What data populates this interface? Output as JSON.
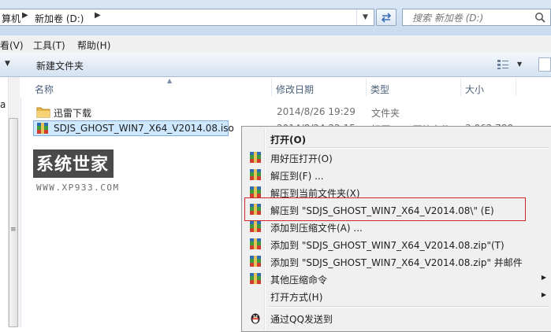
{
  "address": {
    "crumbs": [
      "算机",
      "新加卷 (D:)"
    ],
    "search_placeholder": "搜索 新加卷 (D:)"
  },
  "menubar": {
    "items": [
      "看(V)",
      "工具(T)",
      "帮助(H)"
    ]
  },
  "toolbar": {
    "new_folder": "新建文件夹"
  },
  "nav": {
    "partial_text": "a"
  },
  "columns": {
    "name": "名称",
    "date": "修改日期",
    "type": "类型",
    "size": "大小"
  },
  "files": [
    {
      "name": "迅雷下载",
      "date": "2014/8/26 19:29",
      "type": "文件夹",
      "size": "",
      "icon": "folder-icon"
    },
    {
      "name": "SDJS_GHOST_WIN7_X64_V2014.08.iso",
      "date": "2014/8/24 22:15",
      "type": "好压 ISO 压缩文件",
      "size": "3,062,788",
      "icon": "archive-icon"
    }
  ],
  "watermark": {
    "logo": "系统世家",
    "url": "WWW.XP933.COM"
  },
  "context_menu": {
    "items": [
      {
        "label": "打开(O)",
        "bold": true,
        "icon": "",
        "submenu": false
      },
      {
        "label": "用好压打开(O)",
        "icon": "archive-icon",
        "submenu": false
      },
      {
        "label": "解压到(F) ...",
        "icon": "archive-icon",
        "submenu": false
      },
      {
        "label": "解压到当前文件夹(X)",
        "icon": "archive-icon",
        "submenu": false
      },
      {
        "label": "解压到 \"SDJS_GHOST_WIN7_X64_V2014.08\\\" (E)",
        "icon": "archive-icon",
        "submenu": false,
        "highlighted": true
      },
      {
        "label": "添加到压缩文件(A) ...",
        "icon": "archive-icon",
        "submenu": false
      },
      {
        "label": "添加到 \"SDJS_GHOST_WIN7_X64_V2014.08.zip\"(T)",
        "icon": "archive-icon",
        "submenu": false
      },
      {
        "label": "添加到 \"SDJS_GHOST_WIN7_X64_V2014.08.zip\" 并邮件",
        "icon": "archive-icon",
        "submenu": false
      },
      {
        "label": "其他压缩命令",
        "icon": "archive-icon",
        "submenu": true
      },
      {
        "label": "打开方式(H)",
        "icon": "",
        "submenu": true
      },
      {
        "label": "通过QQ发送到",
        "icon": "qq-penguin-icon",
        "submenu": false
      }
    ],
    "highlight_color": "#d0262c"
  }
}
